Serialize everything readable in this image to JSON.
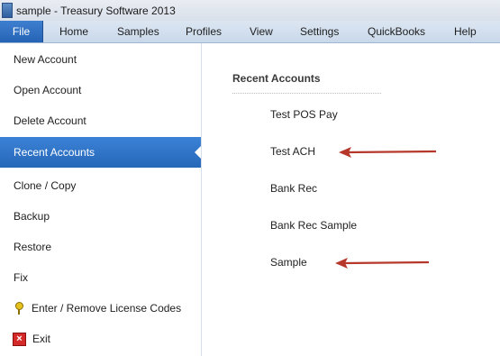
{
  "window": {
    "title": "sample - Treasury Software 2013"
  },
  "tabs": [
    "File",
    "Home",
    "Samples",
    "Profiles",
    "View",
    "Settings",
    "QuickBooks",
    "Help"
  ],
  "sidebar": {
    "items": [
      {
        "label": "New Account"
      },
      {
        "label": "Open Account"
      },
      {
        "label": "Delete Account"
      },
      {
        "label": "Recent Accounts",
        "selected": true
      },
      {
        "label": "Clone / Copy"
      },
      {
        "label": "Backup"
      },
      {
        "label": "Restore"
      },
      {
        "label": "Fix"
      },
      {
        "label": "Enter / Remove License Codes",
        "icon": "key-icon"
      },
      {
        "label": "Exit",
        "icon": "exit-icon"
      }
    ]
  },
  "main": {
    "section_title": "Recent Accounts",
    "recent_accounts": [
      "Test POS Pay",
      "Test ACH",
      "Bank Rec",
      "Bank Rec Sample",
      "Sample"
    ]
  },
  "colors": {
    "selected": "#2f74c9",
    "arrow": "#b5382a"
  }
}
